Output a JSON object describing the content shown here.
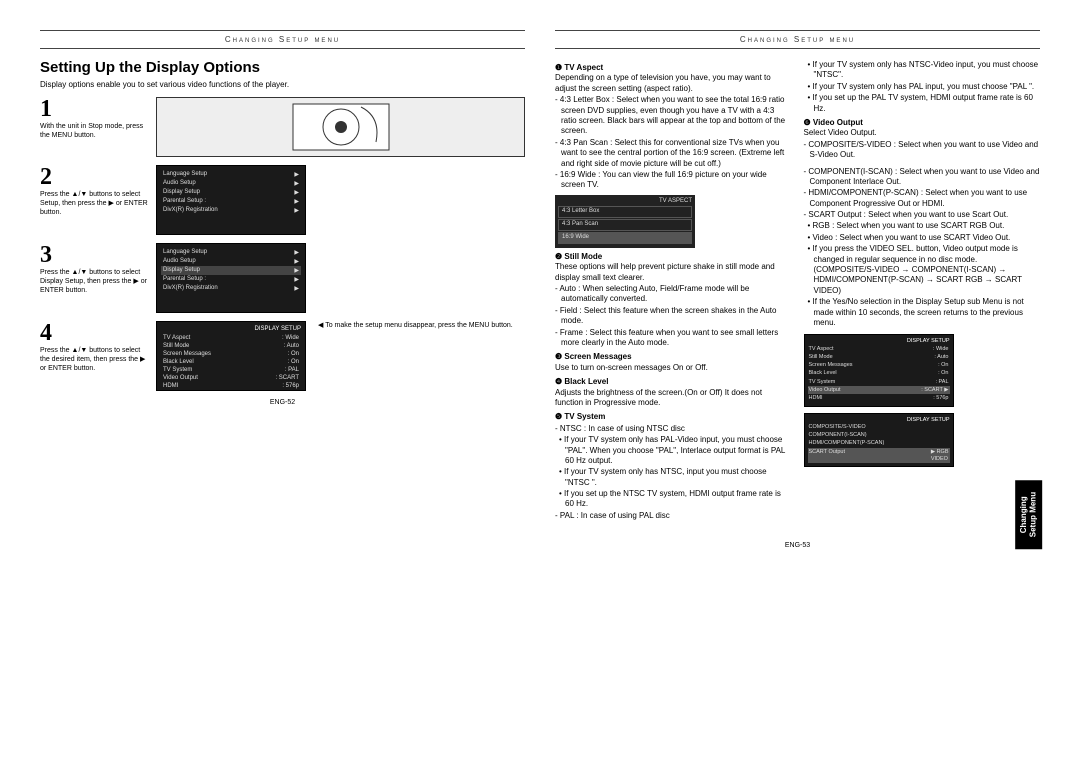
{
  "leftHeader": "Changing Setup menu",
  "rightHeader": "Changing Setup menu",
  "sideTab": "Changing\nSetup Menu",
  "mainTitle": "Setting Up the Display Options",
  "intro": "Display options enable you to set various video functions of the player.",
  "steps": {
    "s1": {
      "num": "1",
      "text": "With the unit in Stop mode, press the MENU button."
    },
    "s2": {
      "num": "2",
      "text": "Press the ▲/▼ buttons to select Setup, then press the ▶ or ENTER button."
    },
    "s3": {
      "num": "3",
      "text": "Press the ▲/▼ buttons to select Display Setup, then press the ▶ or ENTER button."
    },
    "s4": {
      "num": "4",
      "text": "Press the ▲/▼ buttons to select the desired item, then press the ▶ or ENTER button."
    }
  },
  "leftNote": "◀ To make the setup menu disappear, press the MENU button.",
  "leftFooter": "ENG-52",
  "rightFooter": "ENG-53",
  "setupMenuItems": [
    "Language Setup",
    "Audio Setup",
    "Display Setup",
    "Parental Setup :",
    "DivX(R) Registration"
  ],
  "displaySetupItems": [
    {
      "k": "TV Aspect",
      "v": ": Wide"
    },
    {
      "k": "Still Mode",
      "v": ": Auto"
    },
    {
      "k": "Screen Messages",
      "v": ": On"
    },
    {
      "k": "Black Level",
      "v": ": On"
    },
    {
      "k": "TV System",
      "v": ": PAL"
    },
    {
      "k": "Video Output",
      "v": ": SCART"
    },
    {
      "k": "HDMI",
      "v": ": 576p"
    }
  ],
  "tvAspectTitle": "TV ASPECT",
  "tvAspectOptions": [
    "4:3 Letter Box",
    "4:3 Pan Scan",
    "16:9 Wide"
  ],
  "videoOutItems": [
    {
      "k": "COMPOSITE/S-VIDEO",
      "v": ""
    },
    {
      "k": "COMPONENT(I-SCAN)",
      "v": ""
    },
    {
      "k": "HDMI/COMPONENT(P-SCAN)",
      "v": ""
    },
    {
      "k": "SCART Output",
      "v": ": RGB"
    }
  ],
  "opt1": {
    "title": "❶ TV Aspect",
    "lead": "Depending on a type of television you have, you may want to adjust the screen setting (aspect ratio).",
    "items": [
      "- 4:3 Letter Box : Select when you want to see the total 16:9 ratio screen DVD supplies, even though you have a TV with a 4:3 ratio screen. Black bars will appear at the top and bottom of the screen.",
      "- 4:3 Pan Scan : Select this for conventional size TVs when you want to see the central portion of the 16:9 screen. (Extreme left and right side of movie picture will be cut off.)",
      "- 16:9 Wide : You can view the full 16:9 picture on your wide screen TV."
    ]
  },
  "opt2": {
    "title": "❷ Still Mode",
    "lead": "These options will help prevent picture shake in still mode and display small text clearer.",
    "items": [
      "- Auto : When selecting Auto, Field/Frame mode will be automatically converted.",
      "- Field : Select this feature when the screen shakes in the Auto mode.",
      "- Frame : Select this feature when you want to see small letters more clearly in the Auto mode."
    ]
  },
  "opt3": {
    "title": "❸ Screen Messages",
    "lead": "Use to turn on-screen messages On or Off."
  },
  "opt4": {
    "title": "❹ Black Level",
    "lead": "Adjusts the brightness of the screen.(On or Off) It does not function in Progressive mode."
  },
  "opt5": {
    "title": "❺ TV System",
    "items": [
      "- NTSC : In case of using NTSC disc",
      "• If your TV system only has PAL-Video input, you must choose \"PAL\". When you choose \"PAL\", Interlace output format is PAL 60 Hz output.",
      "• If your TV system only has NTSC, input you must choose \"NTSC \".",
      "• If you set up the NTSC TV system, HDMI output frame rate is 60 Hz.",
      "- PAL : In case of using PAL disc"
    ]
  },
  "opt5_cont": [
    "• If your TV system only has NTSC-Video input, you must choose \"NTSC\".",
    "• If your TV system only has PAL input, you must choose \"PAL \".",
    "• If you set up the PAL TV system, HDMI output frame rate is 60 Hz."
  ],
  "opt6": {
    "title": "❻ Video Output",
    "lead": "Select Video Output.",
    "items": [
      "- COMPOSITE/S-VIDEO : Select when you want to use Video and S-Video Out.",
      "- COMPONENT(I-SCAN) : Select when you want to use Video and Component Interlace Out.",
      "- HDMI/COMPONENT(P-SCAN) : Select when you want to use Component Progressive Out or HDMI.",
      "- SCART Output : Select when you want to use Scart Out.",
      "• RGB : Select when you want to use SCART RGB Out.",
      "• Video : Select when you want to use SCART Video Out.",
      "• If you press the VIDEO SEL. button, Video output mode is changed in regular sequence in no disc mode. (COMPOSITE/S-VIDEO → COMPONENT(I-SCAN) → HDMI/COMPONENT(P-SCAN) → SCART RGB → SCART VIDEO)",
      "• If the Yes/No selection in the Display Setup sub Menu is not made within 10 seconds, the screen returns to the previous menu."
    ]
  }
}
